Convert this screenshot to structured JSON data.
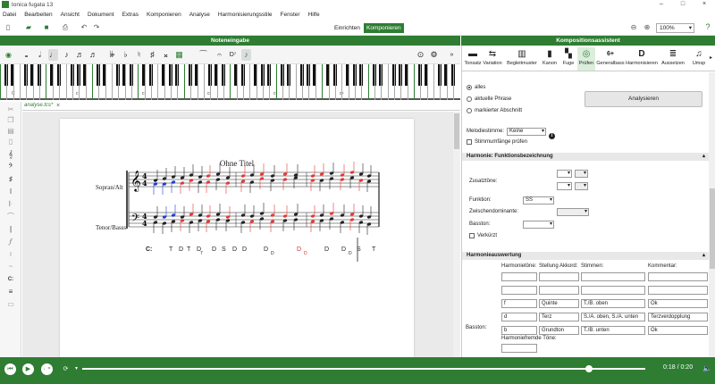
{
  "window": {
    "title": "tonica fugata 13"
  },
  "menu": [
    "Datei",
    "Bearbeiten",
    "Ansicht",
    "Dokument",
    "Extras",
    "Komponieren",
    "Analyse",
    "Harmonisierungsstile",
    "Fenster",
    "Hilfe"
  ],
  "toolbar": {
    "mode_einrichten": "Einrichten",
    "mode_komponieren": "Komponieren",
    "zoom": "100%",
    "accent": "#2e7d32"
  },
  "notes_panel": {
    "title": "Noteneingabe"
  },
  "keyboard": {
    "labels": [
      "C",
      "c",
      "c¹",
      "c²",
      "c³",
      "c⁴"
    ]
  },
  "doc_tab": {
    "name": "analyse.tcs*"
  },
  "score": {
    "title": "Ohne Titel",
    "staff1": "Sopran/Alt",
    "staff2": "Tenor/Basss",
    "functions": [
      "C:",
      "T",
      "D",
      "T",
      "D",
      "D",
      "S",
      "D",
      "D",
      "D",
      "D",
      "D",
      "D",
      "S",
      "T"
    ],
    "func_subs": {
      "4": "7",
      "9": "D",
      "10": "D",
      "12": "D"
    }
  },
  "right_panel": {
    "title": "Kompositionsassistent",
    "tabs": [
      "Tonsatz",
      "Variation",
      "Begleitmuster",
      "Kanon",
      "Fuge",
      "Prüfen",
      "Generalbass",
      "Harmonisieren",
      "Aussetzen",
      "Umsp"
    ],
    "selected_tab": "Prüfen",
    "scope": [
      "alles",
      "aktuelle Phrase",
      "markierter Abschnitt"
    ],
    "analyze_button": "Analysieren",
    "melody_label": "Melodiestimme:",
    "melody_value": "Keine",
    "check_ranges": "Stimmumfänge prüfen",
    "section_harmony": "Harmonie: Funktionsbezeichnung",
    "zusatztoene": "Zusatztöne:",
    "funktion_label": "Funktion:",
    "funktion_value": "SS",
    "zwischendominante": "Zwischendominante:",
    "basston": "Basston:",
    "verkuerzt": "Verkürzt",
    "section_eval": "Harmonieauswertung",
    "columns": [
      "Harmonietöne:",
      "Stellung Akkord:",
      "Stimmen:",
      "Kommentar:"
    ],
    "rows": [
      [
        "",
        "",
        "",
        ""
      ],
      [
        "",
        "",
        "",
        ""
      ],
      [
        "f",
        "Quinte",
        "T./B. oben",
        "Ok"
      ],
      [
        "d",
        "Terz",
        "S./A. oben, S./A. unten",
        "Terzverdopplung"
      ],
      [
        "b",
        "Grundton",
        "T./B. unten",
        "Ok"
      ]
    ],
    "basston_row_label": "Basston:",
    "nonchord": "Harmoniefremde Töne:"
  },
  "player": {
    "time": "0:18 / 0:20",
    "progress_fraction": 0.9
  }
}
